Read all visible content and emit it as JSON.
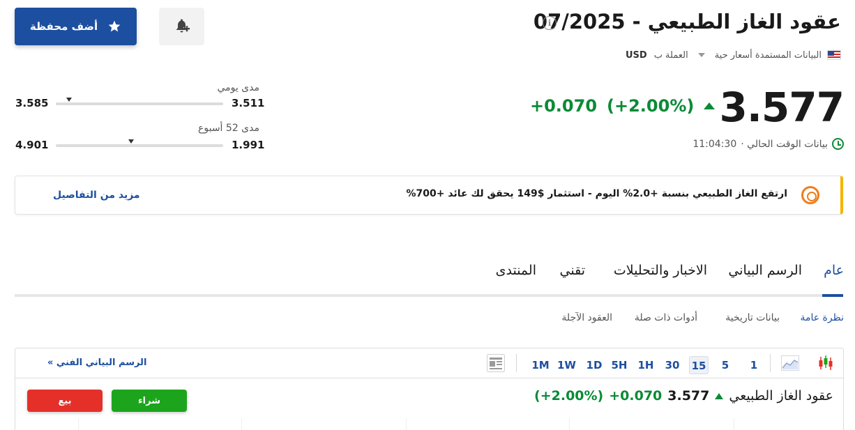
{
  "header": {
    "title": "عقود الغاز الطبيعي - 07/2025",
    "add_portfolio_label": "أضف محفظة",
    "meta": {
      "data_source": "البيانات المستمدة أسعار حية",
      "currency_label": "العملة ب",
      "currency": "USD"
    }
  },
  "quote": {
    "price": "3.577",
    "change": "+0.070",
    "change_pct": "(+2.00%)",
    "time_label": "بيانات الوقت الحالي ·",
    "time": "11:04:30",
    "direction_color": "#0a8a36"
  },
  "ranges": {
    "daily": {
      "label": "مدى يومي",
      "low": "3.511",
      "high": "3.585",
      "position": 0.92
    },
    "week52": {
      "label": "مدى 52 أسبوع",
      "low": "1.991",
      "high": "4.901",
      "position": 0.55
    }
  },
  "promo": {
    "text": "ارتفع الغاز الطبيعي بنسبة +2.0% اليوم - استثمار $149 يحقق لك عائد +700%",
    "link": "مزيد من التفاصيل"
  },
  "tabs": [
    {
      "label": "عام"
    },
    {
      "label": "الرسم البياني"
    },
    {
      "label": "الاخبار والتحليلات"
    },
    {
      "label": "تقني"
    },
    {
      "label": "المنتدى"
    }
  ],
  "subtabs": [
    {
      "label": "نظرة عامة"
    },
    {
      "label": "بيانات تاريخية"
    },
    {
      "label": "أدوات ذات صلة"
    },
    {
      "label": "العقود الآجلة"
    }
  ],
  "chart_widget": {
    "timeframes": [
      "1",
      "5",
      "15",
      "30",
      "1H",
      "5H",
      "1D",
      "1W",
      "1M"
    ],
    "active_timeframe": "15",
    "tech_chart_link": "الرسم البياني الفني »",
    "instrument": "عقود الغاز الطبيعي",
    "price": "3.577",
    "change": "+0.070",
    "change_pct": "(+2.00%)",
    "buy_label": "شراء",
    "sell_label": "بيع"
  },
  "colors": {
    "brand_blue": "#1d4fa0",
    "up_green": "#0a8a36",
    "buy_green": "#1ca51c",
    "sell_red": "#e5302a",
    "promo_accent": "#f5b400"
  }
}
